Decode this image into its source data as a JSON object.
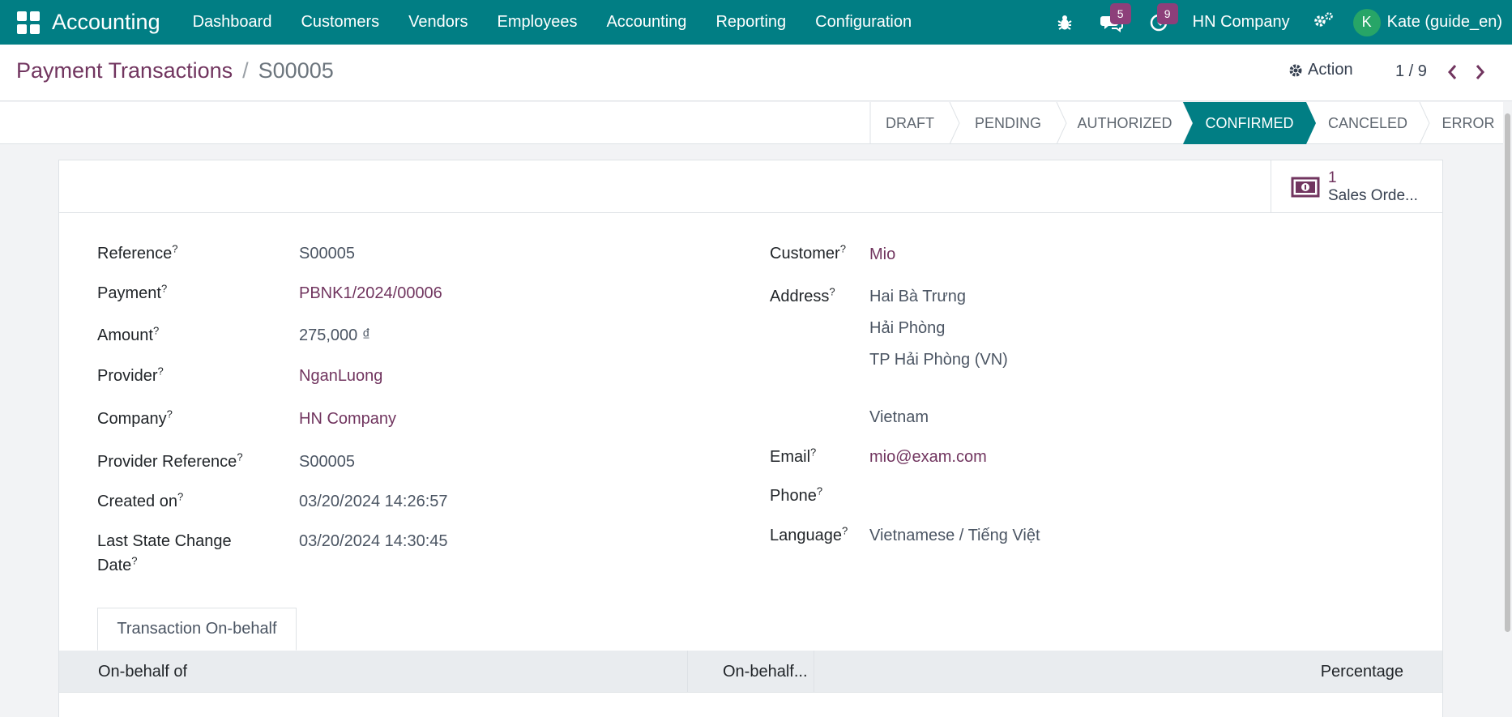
{
  "navbar": {
    "app_name": "Accounting",
    "menu": [
      "Dashboard",
      "Customers",
      "Vendors",
      "Employees",
      "Accounting",
      "Reporting",
      "Configuration"
    ],
    "messages_count": "5",
    "activities_count": "9",
    "company": "HN Company",
    "avatar_initial": "K",
    "user": "Kate (guide_en)"
  },
  "control": {
    "breadcrumb_parent": "Payment Transactions",
    "breadcrumb_sep": "/",
    "breadcrumb_current": "S00005",
    "action_label": "Action",
    "pager": "1 / 9"
  },
  "statusbar": {
    "steps": [
      "DRAFT",
      "PENDING",
      "AUTHORIZED",
      "CONFIRMED",
      "CANCELED",
      "ERROR"
    ],
    "active_step": "CONFIRMED",
    "active_color": "#017e84"
  },
  "smart_button": {
    "count": "1",
    "label": "Sales Orde..."
  },
  "left_fields": [
    {
      "label": "Reference",
      "value": "S00005"
    },
    {
      "label": "Payment",
      "value": "PBNK1/2024/00006"
    },
    {
      "label": "Amount",
      "value": "275,000 ₫"
    },
    {
      "label": "Provider",
      "value": "NganLuong"
    },
    {
      "label": "Company",
      "value": "HN Company"
    },
    {
      "label": "Provider Reference",
      "value": "S00005"
    },
    {
      "label": "Created on",
      "value": "03/20/2024 14:26:57"
    },
    {
      "label": "Last State Change",
      "label2": "Date",
      "value": "03/20/2024 14:30:45"
    }
  ],
  "right_fields": {
    "customer_label": "Customer",
    "customer": "Mio",
    "address_label": "Address",
    "address_lines": [
      "Hai Bà Trưng",
      "Hải Phòng",
      "TP Hải Phòng (VN)",
      "Vietnam"
    ],
    "email_label": "Email",
    "email": "mio@exam.com",
    "phone_label": "Phone",
    "language_label": "Language",
    "language": "Vietnamese / Tiếng Việt"
  },
  "help_marker": "?",
  "tabs": {
    "active": "Transaction On-behalf"
  },
  "table": {
    "columns": [
      "On-behalf of",
      "On-behalf...",
      "Percentage"
    ]
  },
  "colors": {
    "navbar": "#017e84",
    "link": "#71355f",
    "badge": "#8d3f7a"
  }
}
